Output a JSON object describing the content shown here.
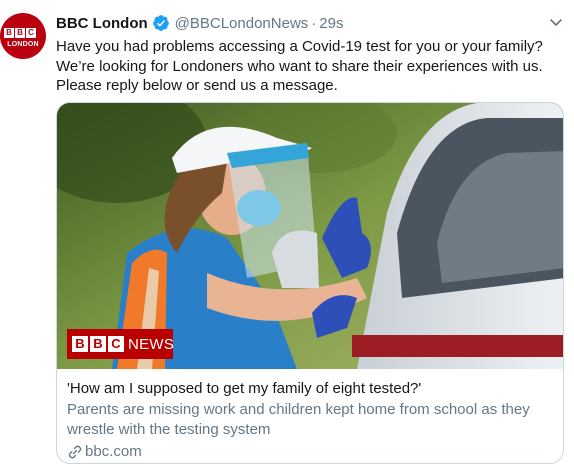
{
  "author": {
    "display_name": "BBC London",
    "handle": "@BBCLondonNews",
    "separator": "·",
    "time": "29s",
    "avatar_letters": [
      "B",
      "B",
      "C"
    ],
    "avatar_subtitle": "LONDON",
    "verified_icon": "verified-badge-icon"
  },
  "tweet": {
    "lines": [
      "Have you had problems accessing a Covid-19 test for you or your family?",
      "We’re looking for Londoners who want to share their experiences with us.",
      "Please reply below or send us a message."
    ]
  },
  "card": {
    "badge_letters": [
      "B",
      "B",
      "C"
    ],
    "badge_word": "NEWS",
    "title": "'How am I supposed to get my family of eight tested?'",
    "description_lines": [
      "Parents are missing work and children kept home from school as they",
      "wrestle with the testing system"
    ],
    "domain": "bbc.com",
    "link_icon": "link-icon"
  },
  "colors": {
    "text_primary": "#14171a",
    "text_secondary": "#657786",
    "verified_blue": "#1da1f2",
    "bbc_red": "#b80000",
    "card_border": "#ccd6dd"
  }
}
